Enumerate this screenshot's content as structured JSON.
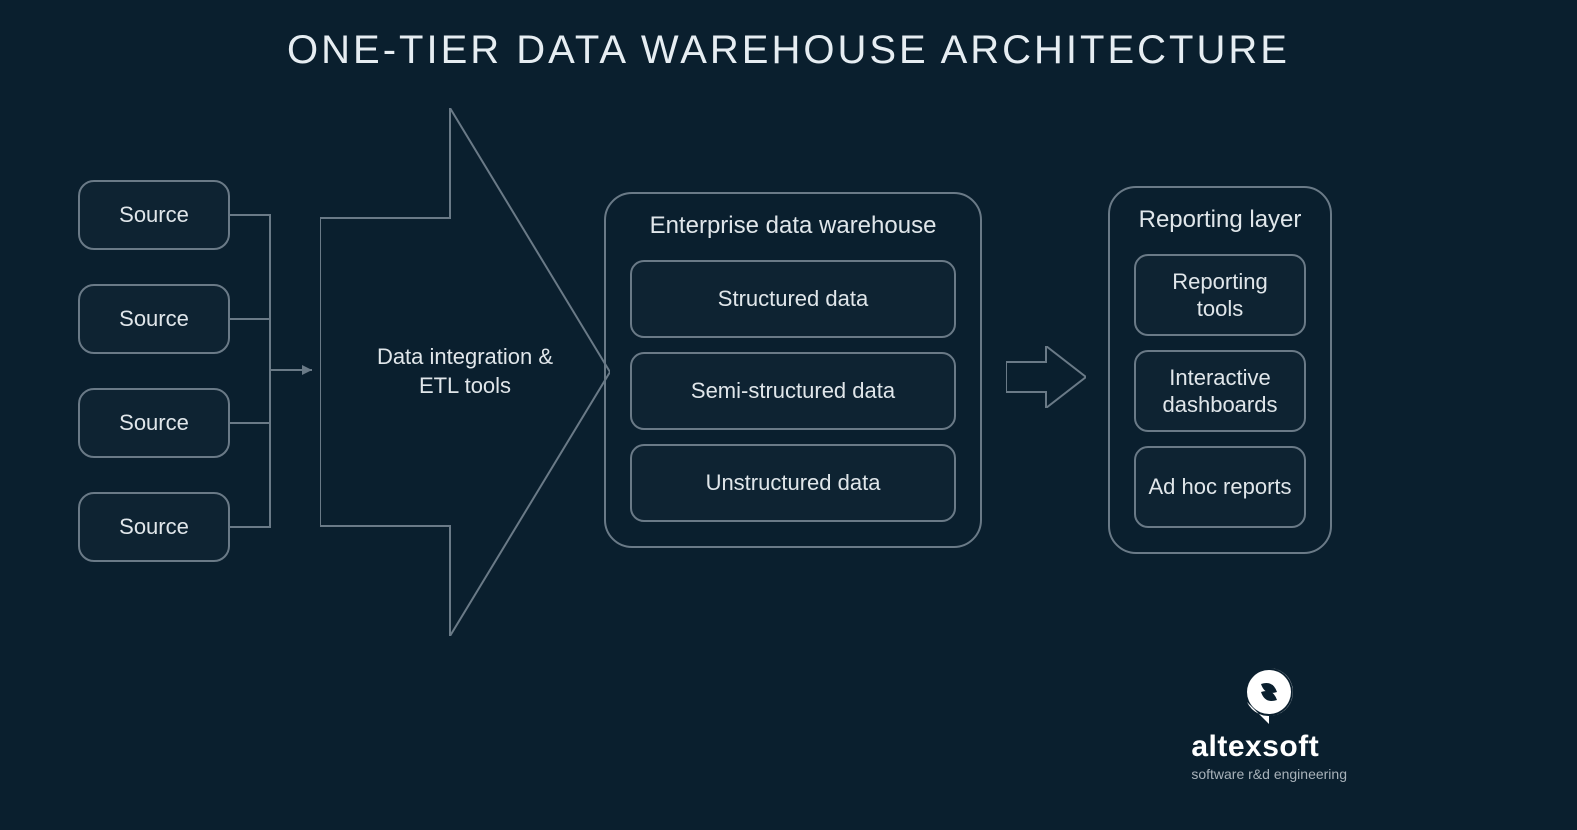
{
  "title": "ONE-TIER DATA WAREHOUSE ARCHITECTURE",
  "sources": [
    "Source",
    "Source",
    "Source",
    "Source"
  ],
  "etl": {
    "label": "Data integration & ETL tools"
  },
  "warehouse": {
    "title": "Enterprise data warehouse",
    "items": [
      "Structured data",
      "Semi-structured data",
      "Unstructured data"
    ]
  },
  "reporting": {
    "title": "Reporting layer",
    "items": [
      "Reporting tools",
      "Interactive dashboards",
      "Ad hoc reports"
    ]
  },
  "brand": {
    "name": "altexsoft",
    "tagline": "software r&d engineering"
  },
  "colors": {
    "bg": "#0a1f2e",
    "stroke": "#6a7a87",
    "text": "#e0e6ea"
  }
}
